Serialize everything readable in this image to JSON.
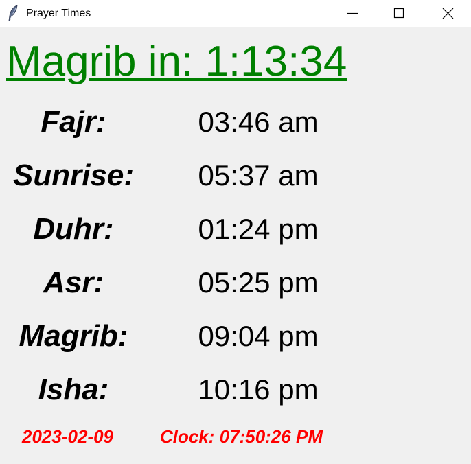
{
  "window": {
    "title": "Prayer Times",
    "icon": "feather-icon"
  },
  "countdown": {
    "text": "Magrib in: 1:13:34",
    "color": "#008000"
  },
  "prayers": [
    {
      "name": "Fajr:",
      "time": "03:46 am"
    },
    {
      "name": "Sunrise:",
      "time": "05:37 am"
    },
    {
      "name": "Duhr:",
      "time": "01:24 pm"
    },
    {
      "name": "Asr:",
      "time": "05:25 pm"
    },
    {
      "name": "Magrib:",
      "time": "09:04 pm"
    },
    {
      "name": "Isha:",
      "time": "10:16 pm"
    }
  ],
  "footer": {
    "date": "2023-02-09",
    "clock": "Clock: 07:50:26 PM",
    "color": "#ff0000"
  }
}
